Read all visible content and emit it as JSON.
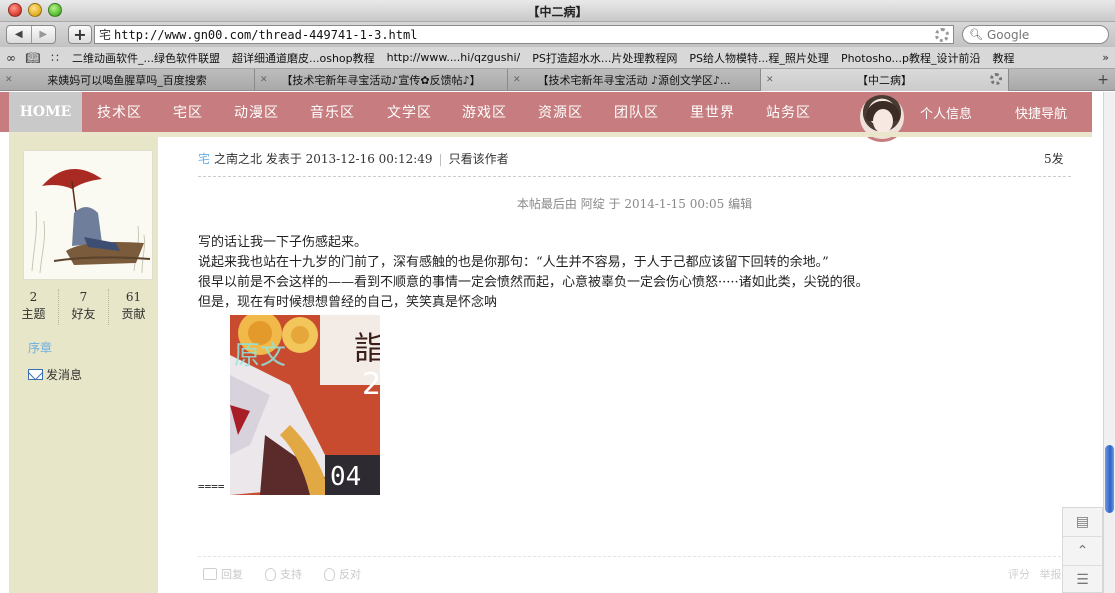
{
  "window": {
    "title": "【中二病】"
  },
  "toolbar": {
    "back_label": "◀",
    "forward_label": "▶",
    "add_label": "+",
    "url": "http://www.gn00.com/thread-449741-1-3.html",
    "search_placeholder": "Google"
  },
  "bookmarks": {
    "items": [
      {
        "label": "二维动画软件_...绿色软件联盟"
      },
      {
        "label": "超详细通道磨皮...oshop教程"
      },
      {
        "label": "http://www....hi/qzgushi/"
      },
      {
        "label": "PS打造超水水...片处理教程网"
      },
      {
        "label": "PS给人物模特...程_照片处理"
      },
      {
        "label": "Photosho...p教程_设计前沿"
      },
      {
        "label": "教程"
      }
    ],
    "more_label": "»"
  },
  "tabs": [
    {
      "label": "来姨妈可以喝鱼腥草吗_百度搜索"
    },
    {
      "label": "【技术宅新年寻宝活动♪宣传✿反馈帖♪】"
    },
    {
      "label": "【技术宅新年寻宝活动 ♪源创文学区♪..."
    },
    {
      "label": "【中二病】"
    }
  ],
  "site_nav": {
    "home": "HOME",
    "items": [
      {
        "label": "技术区"
      },
      {
        "label": "宅区"
      },
      {
        "label": "动漫区"
      },
      {
        "label": "音乐区"
      },
      {
        "label": "文学区"
      },
      {
        "label": "游戏区"
      },
      {
        "label": "资源区"
      },
      {
        "label": "团队区"
      },
      {
        "label": "里世界"
      },
      {
        "label": "站务区"
      }
    ],
    "profile": "个人信息",
    "quick_nav": "快捷导航"
  },
  "sidebar": {
    "stats": [
      {
        "value": "2",
        "label": "主题"
      },
      {
        "value": "7",
        "label": "好友"
      },
      {
        "value": "61",
        "label": "贡献"
      }
    ],
    "rank": "序章",
    "send_message": "发消息"
  },
  "post": {
    "group_tag": "宅",
    "meta": "之南之北 发表于 2013-12-16 00:12:49",
    "only_author": "只看该作者",
    "floor": "5发",
    "edit_note": "本帖最后由 阿绽 于 2014-1-15 00:05 编辑",
    "lines": [
      "写的话让我一下子伤感起来。",
      "说起来我也站在十九岁的门前了，深有感触的也是你那句：“人生并不容易，于人于己都应该留下回转的余地。”",
      "很早以前是不会这样的——看到不顺意的事情一定会愤然而起，心意被辜负一定会伤心愤怒·····诸如此类，尖锐的很。",
      "但是，现在有时候想想曾经的自己，笑笑真是怀念呐"
    ],
    "image_label": "原文",
    "image_kanji": "詣",
    "image_two": "2",
    "image_number": "04",
    "signature_line": "===="
  },
  "post_actions": {
    "reply": "回复",
    "support": "支持",
    "oppose": "反对",
    "rate": "评分",
    "report": "举报"
  },
  "colors": {
    "nav_bg": "#c77d7f",
    "sidebar_bg": "#e7e6c9",
    "link_blue": "#6aaee6"
  }
}
